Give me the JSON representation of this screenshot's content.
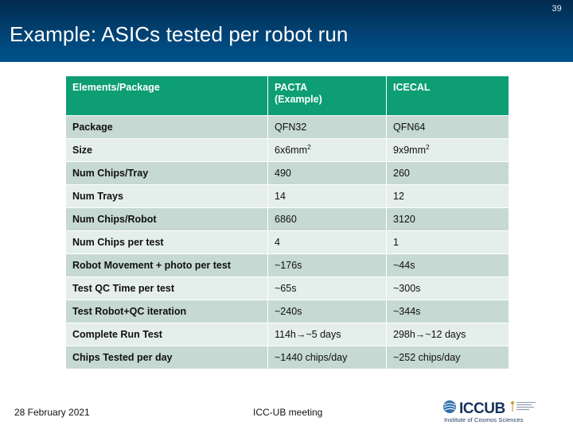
{
  "slide": {
    "number": "39",
    "title": "Example: ASICs tested per robot run"
  },
  "table": {
    "headers": [
      "Elements/Package",
      "PACTA\n(Example)",
      "ICECAL"
    ],
    "header_col1": "Elements/Package",
    "header_col2_line1": "PACTA",
    "header_col2_line2": "(Example)",
    "header_col3": "ICECAL",
    "rows": [
      {
        "label": "Package",
        "pacta": "QFN32",
        "icecal": "QFN64"
      },
      {
        "label": "Size",
        "pacta": "6x6mm",
        "pacta_sup": "2",
        "icecal": "9x9mm",
        "icecal_sup": "2"
      },
      {
        "label": "Num Chips/Tray",
        "pacta": "490",
        "icecal": "260"
      },
      {
        "label": "Num Trays",
        "pacta": "14",
        "icecal": "12"
      },
      {
        "label": "Num Chips/Robot",
        "pacta": "6860",
        "icecal": "3120"
      },
      {
        "label": "Num Chips per test",
        "pacta": "4",
        "icecal": "1"
      },
      {
        "label": "Robot Movement + photo per test",
        "pacta": "~176s",
        "icecal": "~44s"
      },
      {
        "label": "Test QC Time per test",
        "pacta": "~65s",
        "icecal": "~300s"
      },
      {
        "label": "Test Robot+QC iteration",
        "pacta": "~240s",
        "icecal": "~344s"
      },
      {
        "label": "Complete Run Test",
        "pacta": "114h→~5 days",
        "icecal": "298h→~12 days"
      },
      {
        "label": "Chips Tested per day",
        "pacta": "~1440 chips/day",
        "icecal": "~252 chips/day"
      }
    ]
  },
  "footer": {
    "date": "28 February 2021",
    "event": "ICC-UB meeting",
    "logo_word": "ICCUB",
    "logo_tagline": "Institute of Cosmos Sciences"
  },
  "colors": {
    "header_band_top": "#022a4e",
    "header_band_bottom": "#00518c",
    "table_header": "#0d9e73",
    "row_odd": "#c6d9d2",
    "row_even": "#e4eeea",
    "logo_navy": "#16335e"
  }
}
